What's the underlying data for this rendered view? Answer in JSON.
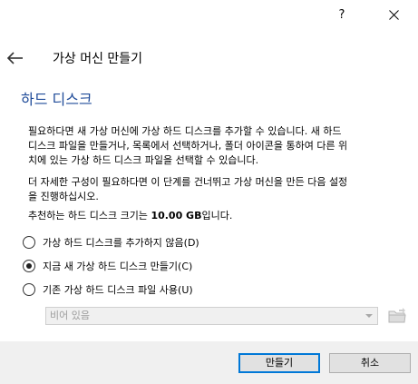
{
  "titlebar": {
    "help_label": "?",
    "close_label": "✕"
  },
  "header": {
    "back_icon": "back-arrow-icon",
    "title": "가상 머신 만들기"
  },
  "section": {
    "title": "하드 디스크"
  },
  "description": {
    "line1": "필요하다면 새 가상 머신에 가상 하드 디스크를 추가할 수 있습니다. 새 하드",
    "line2": "디스크 파일을 만들거나, 목록에서 선택하거나, 폴더 아이콘을 통하여 다른 위",
    "line3": "치에 있는 가상 하드 디스크 파일을 선택할 수 있습니다.",
    "line4": "더 자세한 구성이 필요하다면 이 단계를 건너뛰고 가상 머신을 만든 다음 설정",
    "line5": "을 진행하십시오.",
    "recommend_prefix": "추천하는 하드 디스크 크기는 ",
    "recommend_size": "10.00 GB",
    "recommend_suffix": "입니다."
  },
  "options": [
    {
      "label": "가상 하드 디스크를 추가하지 않음(D)",
      "checked": false
    },
    {
      "label": "지금 새 가상 하드 디스크 만들기(C)",
      "checked": true
    },
    {
      "label": "기존 가상 하드 디스크 파일 사용(U)",
      "checked": false
    }
  ],
  "file_select": {
    "value": "비어 있음",
    "disabled": true,
    "folder_icon": "folder-icon"
  },
  "buttons": {
    "create": "만들기",
    "cancel": "취소"
  }
}
